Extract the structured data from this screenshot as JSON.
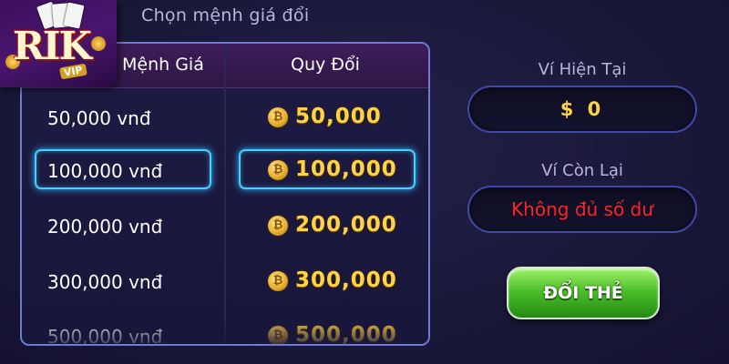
{
  "title": "Chọn mệnh giá đổi",
  "logo": {
    "text": "RIK",
    "badge": "VIP"
  },
  "table": {
    "headers": {
      "denomination": "Mệnh Giá",
      "exchange": "Quy Đổi"
    },
    "rows": [
      {
        "denomination": "50,000 vnđ",
        "reward": "50,000",
        "selected": false
      },
      {
        "denomination": "100,000 vnđ",
        "reward": "100,000",
        "selected": true
      },
      {
        "denomination": "200,000 vnđ",
        "reward": "200,000",
        "selected": false
      },
      {
        "denomination": "300,000 vnđ",
        "reward": "300,000",
        "selected": false
      },
      {
        "denomination": "500,000 vnđ",
        "reward": "500,000",
        "selected": false
      }
    ]
  },
  "wallet": {
    "current_label": "Ví Hiện Tại",
    "current_value": "$ 0",
    "remaining_label": "Ví Còn Lại",
    "remaining_value": "Không đủ số dư"
  },
  "exchange_button": {
    "label": "ĐỔI THẺ"
  },
  "colors": {
    "accent_gold": "#ffd24a",
    "selection_glow": "#4ad0ff",
    "error_red": "#ff2424",
    "button_green": "#4ec02a"
  },
  "icons": {
    "coin": "coin-icon",
    "card_fan": "playing-cards-icon"
  }
}
